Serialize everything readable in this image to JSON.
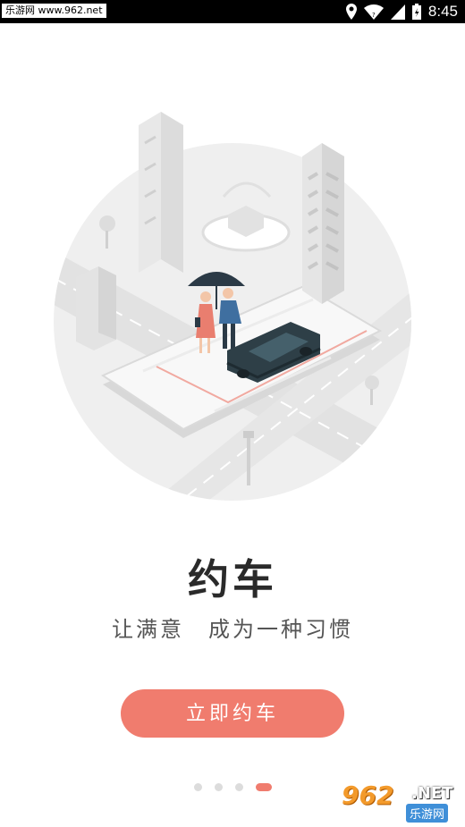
{
  "status_bar": {
    "watermark": "乐游网 www.962.net",
    "time": "8:45",
    "icons": [
      "location-icon",
      "wifi-icon",
      "signal-icon",
      "battery-icon"
    ]
  },
  "illustration": {
    "description_icon": "city-car-illustration-icon"
  },
  "onboarding": {
    "title": "约车",
    "subtitle": "让满意　成为一种习惯",
    "cta_label": "立即约车",
    "page_count": 4,
    "active_page": 4
  },
  "watermark_bottom": {
    "number": "962",
    "suffix": ".NET",
    "site_name": "乐游网"
  },
  "colors": {
    "accent": "#f07c6e",
    "dot_inactive": "#dcdcdc",
    "title": "#2a2a2a",
    "subtitle": "#555555"
  }
}
